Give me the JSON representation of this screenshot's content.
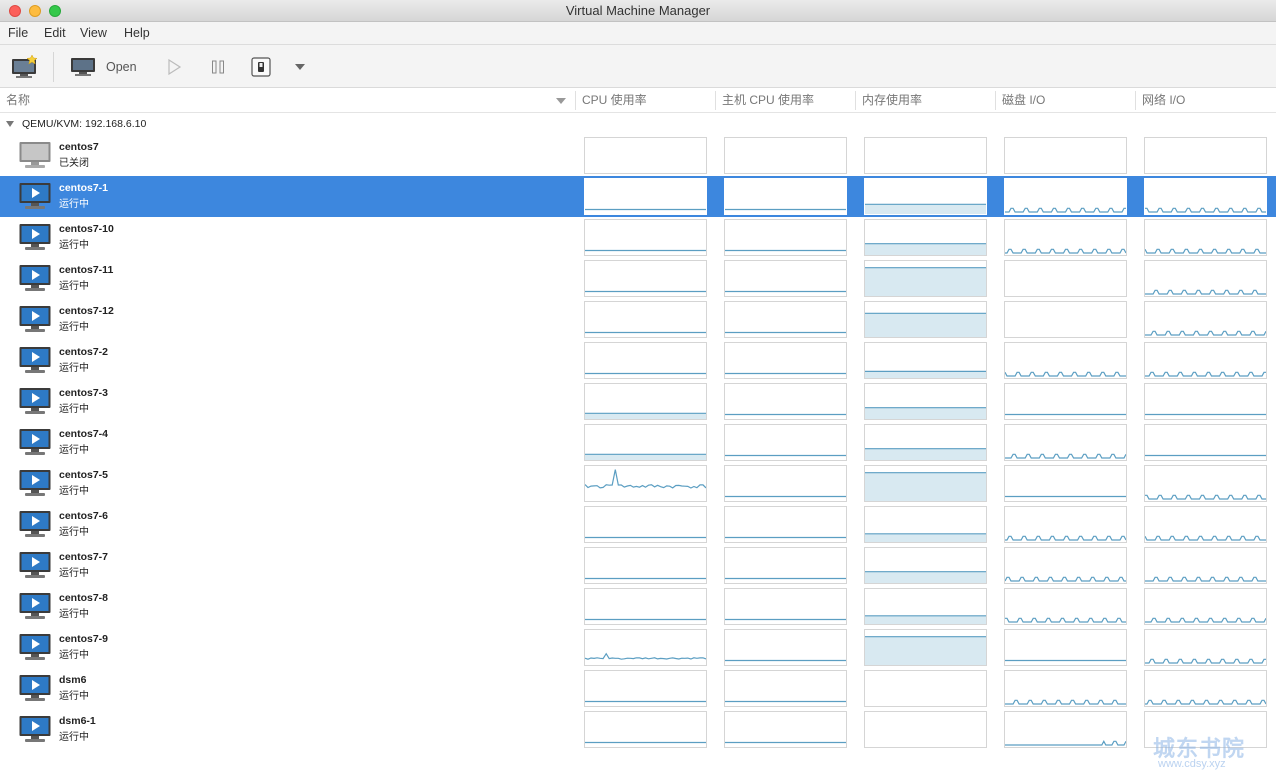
{
  "window": {
    "title": "Virtual Machine Manager"
  },
  "menu": [
    "File",
    "Edit",
    "View",
    "Help"
  ],
  "toolbar": {
    "new_vm_icon": "new-vm-icon",
    "open_label": "Open",
    "run_icon": "play-icon",
    "pause_icon": "pause-icon",
    "shutdown_icon": "shutdown-icon",
    "menu_icon": "chevron-down-icon"
  },
  "columns": [
    "名称",
    "CPU 使用率",
    "主机 CPU 使用率",
    "内存使用率",
    "磁盘 I/O",
    "网络 I/O"
  ],
  "connection": {
    "label": "QEMU/KVM: 192.168.6.10"
  },
  "colors": {
    "selection": "#3d87de",
    "graph_line": "#5b9ec2",
    "graph_fill": "#d8e9f1"
  },
  "vms": [
    {
      "name": "centos7",
      "status": "已关闭",
      "running": false,
      "selected": false,
      "graphs": {
        "cpu": null,
        "host_cpu": null,
        "mem": null,
        "disk": null,
        "net": null
      }
    },
    {
      "name": "centos7-1",
      "status": "运行中",
      "running": true,
      "selected": true,
      "graphs": {
        "cpu": 0.08,
        "host_cpu": 0.08,
        "mem": 0.25,
        "disk": "bumps",
        "net": "bumps"
      }
    },
    {
      "name": "centos7-10",
      "status": "运行中",
      "running": true,
      "selected": false,
      "graphs": {
        "cpu": 0.08,
        "host_cpu": 0.08,
        "mem": 0.3,
        "disk": "bumps",
        "net": "bumps"
      }
    },
    {
      "name": "centos7-11",
      "status": "运行中",
      "running": true,
      "selected": false,
      "graphs": {
        "cpu": 0.08,
        "host_cpu": 0.08,
        "mem": 0.85,
        "disk": null,
        "net": "bumps"
      }
    },
    {
      "name": "centos7-12",
      "status": "运行中",
      "running": true,
      "selected": false,
      "graphs": {
        "cpu": 0.08,
        "host_cpu": 0.08,
        "mem": 0.7,
        "disk": null,
        "net": "bumps"
      }
    },
    {
      "name": "centos7-2",
      "status": "运行中",
      "running": true,
      "selected": false,
      "graphs": {
        "cpu": 0.08,
        "host_cpu": 0.08,
        "mem": 0.15,
        "disk": "bumps",
        "net": "bumps"
      }
    },
    {
      "name": "centos7-3",
      "status": "运行中",
      "running": true,
      "selected": false,
      "graphs": {
        "cpu": 0.12,
        "host_cpu": 0.08,
        "mem": 0.3,
        "disk": 0.08,
        "net": 0.08
      }
    },
    {
      "name": "centos7-4",
      "status": "运行中",
      "running": true,
      "selected": false,
      "graphs": {
        "cpu": 0.12,
        "host_cpu": 0.08,
        "mem": 0.3,
        "disk": "bumps",
        "net": 0.08
      }
    },
    {
      "name": "centos7-5",
      "status": "运行中",
      "running": true,
      "selected": false,
      "graphs": {
        "cpu": "spike",
        "host_cpu": 0.08,
        "mem": 0.85,
        "disk": 0.08,
        "net": "bumps"
      }
    },
    {
      "name": "centos7-6",
      "status": "运行中",
      "running": true,
      "selected": false,
      "graphs": {
        "cpu": 0.08,
        "host_cpu": 0.08,
        "mem": 0.2,
        "disk": "bumps",
        "net": "bumps"
      }
    },
    {
      "name": "centos7-7",
      "status": "运行中",
      "running": true,
      "selected": false,
      "graphs": {
        "cpu": 0.08,
        "host_cpu": 0.08,
        "mem": 0.3,
        "disk": "bumps",
        "net": "bumps"
      }
    },
    {
      "name": "centos7-8",
      "status": "运行中",
      "running": true,
      "selected": false,
      "graphs": {
        "cpu": 0.08,
        "host_cpu": 0.08,
        "mem": 0.2,
        "disk": "bumps",
        "net": "bumps"
      }
    },
    {
      "name": "centos7-9",
      "status": "运行中",
      "running": true,
      "selected": false,
      "graphs": {
        "cpu": "low-noise",
        "host_cpu": 0.08,
        "mem": 0.85,
        "disk": 0.08,
        "net": "bumps"
      }
    },
    {
      "name": "dsm6",
      "status": "运行中",
      "running": true,
      "selected": false,
      "graphs": {
        "cpu": 0.08,
        "host_cpu": 0.08,
        "mem": null,
        "disk": "bumps",
        "net": "bumps"
      }
    },
    {
      "name": "dsm6-1",
      "status": "运行中",
      "running": true,
      "selected": false,
      "graphs": {
        "cpu": 0.08,
        "host_cpu": 0.08,
        "mem": null,
        "disk": "bumps-end",
        "net": null
      }
    }
  ],
  "watermark": {
    "text": "城东书院",
    "sub": "www.cdsy.xyz"
  }
}
